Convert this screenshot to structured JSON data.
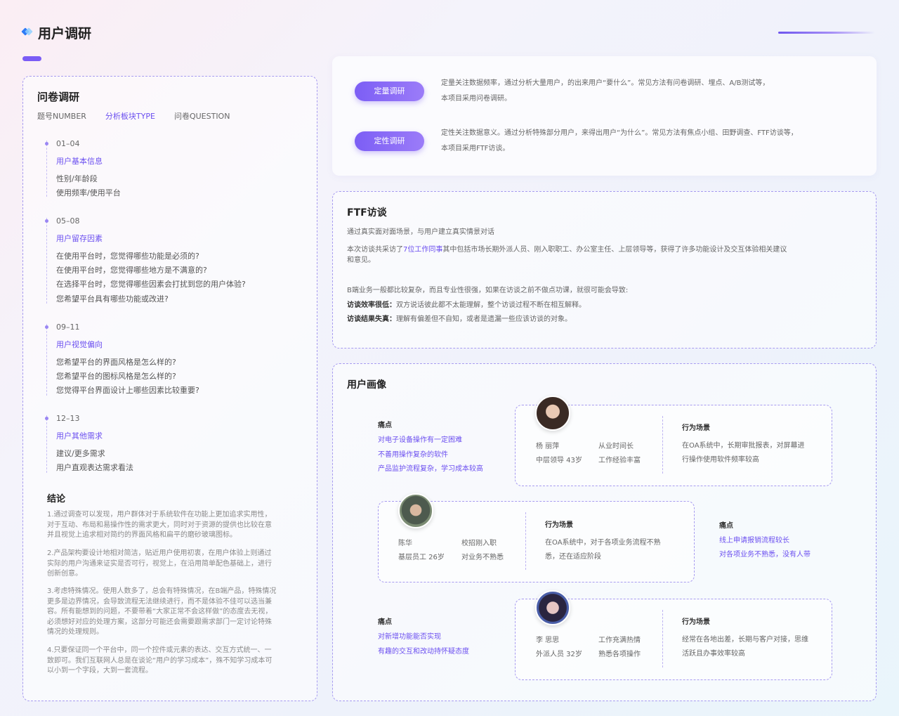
{
  "header": {
    "title": "用户调研"
  },
  "questionnaire": {
    "title": "问卷调研",
    "tabs": [
      "题号NUMBER",
      "分析板块TYPE",
      "问卷QUESTION"
    ],
    "groups": [
      {
        "num": "01–04",
        "title": "用户基本信息",
        "items": [
          "性别/年龄段",
          "使用频率/使用平台"
        ]
      },
      {
        "num": "05–08",
        "title": "用户留存因素",
        "items": [
          "在使用平台时，您觉得哪些功能是必须的?",
          "在使用平台时，您觉得哪些地方是不满意的?",
          "在选择平台时，您觉得哪些因素会打扰到您的用户体验?",
          "您希望平台具有哪些功能或改进?"
        ]
      },
      {
        "num": "09–11",
        "title": "用户视觉偏向",
        "items": [
          "您希望平台的界面风格是怎么样的?",
          "您希望平台的图标风格是怎么样的?",
          "您觉得平台界面设计上哪些因素比较重要?"
        ]
      },
      {
        "num": "12–13",
        "title": "用户其他需求",
        "items": [
          "建议/更多需求",
          "用户直观表达需求看法"
        ]
      }
    ],
    "conclusion_title": "结论",
    "conclusions": [
      [
        "1.通过调查可以发现，用户群体对于系统软件在功能上更加追求实用性，",
        "对于互动、布局和易操作性的需求更大，同时对于资源的提供也比较在意",
        "并且视觉上追求相对简约的界面风格和扁平的磨砂玻璃图标。"
      ],
      [
        "2.产品架构要设计地相对简洁，贴近用户使用初衷，在用户体验上则通过",
        "实际的用户沟通来证实是否可行，视觉上，在沿用简单配色基础上，进行",
        "创新创意。"
      ],
      [
        "3.考虑特殊情况。使用人数多了，总会有特殊情况，在B端产品，特殊情况",
        "更多是边界情况，会导致流程无法继续进行，而不是体验不佳可以选当兼",
        "容。所有能想到的问题，不要带着“大家正常不会这样做”的态度去无视，",
        "必须想好对应的处理方案，这部分可能还会需要跟需求部门一定讨论特殊",
        "情况的处理规则。"
      ],
      [
        "4.只要保证同一个平台中，同一个控件或元素的表达、交互方式统一、一",
        "致即可。我们互联网人总是在谈论“用户的学习成本”，殊不知学习成本可",
        "以小到一个字段，大到一套流程。"
      ]
    ]
  },
  "methods": [
    {
      "label": "定量调研",
      "lines": [
        "定量关注数据频率，通过分析大量用户，的出来用户“要什么”。常见方法有问卷调研、埋点、A/B测试等，",
        "本项目采用问卷调研。"
      ]
    },
    {
      "label": "定性调研",
      "lines": [
        "定性关注数据意义。通过分析特殊部分用户，来得出用户“为什么”。常见方法有焦点小组、田野调查、FTF访谈等，",
        "本项目采用FTF访谈。"
      ]
    }
  ],
  "ftf": {
    "title": "FTF访谈",
    "intro": "通过真实面对面场景，与用户建立真实情景对话",
    "p1_a": "本次访谈共采访了",
    "p1_hl": "7位工作同事",
    "p1_b": "其中包括市场长期外派人员、刚入职职工、办公室主任、上层领导等，获得了许多功能设计及交互体验相关建议",
    "p1_c": "和意见。",
    "p2": "B端业务一般都比较复杂，而且专业性很强，如果在访谈之前不做点功课，就很可能会导致:",
    "p3_label": "访谈效率很低：",
    "p3_text": "双方说话彼此都不太能理解，整个访谈过程不断在相互解释。",
    "p4_label": "访谈结果失真：",
    "p4_text": "理解有偏差但不自知，或者是遗漏一些应该访谈的对象。"
  },
  "personas": {
    "title": "用户画像",
    "list": [
      {
        "name": "杨 丽萍",
        "role": "中层领导 43岁",
        "trait1": "从业时间长",
        "trait2": "工作经验丰富",
        "scene_title": "行为场景",
        "scene": [
          "在OA系统中，长期审批报表，对屏幕进",
          "行操作使用软件频率较高"
        ],
        "pain_title": "痛点",
        "pains": [
          "对电子设备操作有一定困难",
          "不善用操作复杂的软件",
          "产品监护流程复杂，学习成本较高"
        ]
      },
      {
        "name": "陈华",
        "role": "基层员工 26岁",
        "trait1": "校招刚入职",
        "trait2": "对业务不熟悉",
        "scene_title": "行为场景",
        "scene": [
          "在OA系统中，对于各项业务流程不熟",
          "悉，还在适应阶段"
        ],
        "pain_title": "痛点",
        "pains": [
          "线上申请报销流程较长",
          "对各项业务不熟悉，没有人带"
        ]
      },
      {
        "name": "李 思思",
        "role": "外派人员 32岁",
        "trait1": "工作充满热情",
        "trait2": "熟悉各项操作",
        "scene_title": "行为场景",
        "scene": [
          "经常在各地出差，长期与客户对接，思维",
          "活跃且办事效率较高"
        ],
        "pain_title": "痛点",
        "pains": [
          "对新增功能能否实现",
          "有趣的交互和改动持怀疑态度"
        ]
      }
    ]
  },
  "colors": {
    "accent": "#6b4ff0",
    "button": "#7c5ef5",
    "border": "#a79bf0"
  }
}
